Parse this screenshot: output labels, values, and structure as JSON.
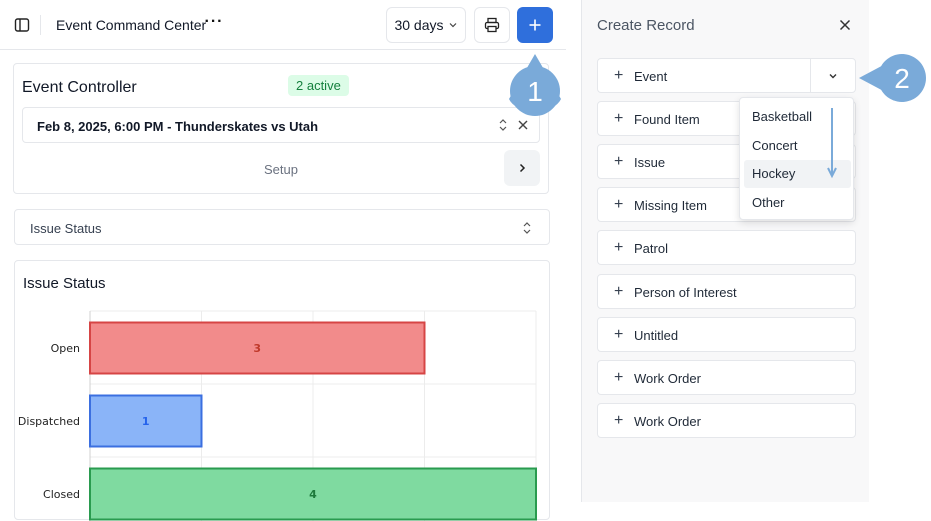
{
  "header": {
    "title": "Event Command Center",
    "more_label": "···",
    "date_range": "30 days"
  },
  "event_controller": {
    "title": "Event Controller",
    "badge": "2 active",
    "selected_event": "Feb 8, 2025, 6:00 PM - Thunderskates vs Utah",
    "setup_label": "Setup"
  },
  "issue_status_select": {
    "label": "Issue Status"
  },
  "chart_data": {
    "type": "bar",
    "orientation": "horizontal",
    "title": "Issue Status",
    "categories": [
      "Open",
      "Dispatched",
      "Closed"
    ],
    "values": [
      3,
      1,
      4
    ],
    "colors": [
      "#f28b8b",
      "#8ab4f8",
      "#7fdaa0"
    ],
    "stroke_colors": [
      "#d64545",
      "#3b6fe0",
      "#2a9b4f"
    ],
    "label_colors": [
      "#c0392b",
      "#2563eb",
      "#1e7a3c"
    ],
    "xlim": [
      0,
      4
    ],
    "grid": true
  },
  "create_record": {
    "title": "Create Record",
    "items": [
      "Event",
      "Found Item",
      "Issue",
      "Missing Item",
      "Patrol",
      "Person of Interest",
      "Untitled",
      "Work Order",
      "Work Order"
    ],
    "event_type_options": [
      "Basketball",
      "Concert",
      "Hockey",
      "Other"
    ],
    "highlighted_option": "Hockey"
  },
  "annotations": {
    "marker_1": "1",
    "marker_2": "2",
    "color": "#7aaad9"
  }
}
